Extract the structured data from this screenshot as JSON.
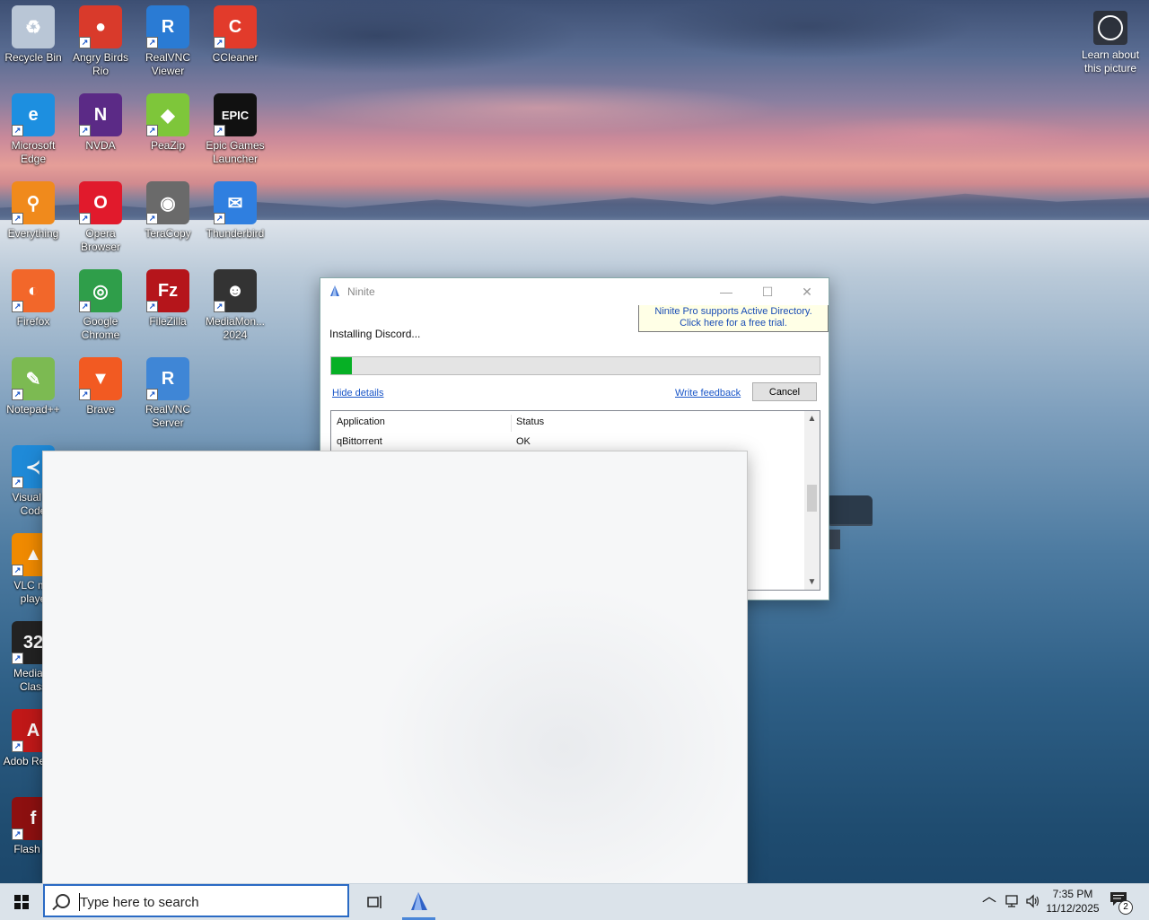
{
  "desktop": {
    "icons": [
      {
        "label": "Recycle Bin",
        "icon": "recycle-bin-icon"
      },
      {
        "label": "Angry Birds Rio",
        "icon": "angry-birds-icon"
      },
      {
        "label": "RealVNC Viewer",
        "icon": "realvnc-viewer-icon"
      },
      {
        "label": "CCleaner",
        "icon": "ccleaner-icon"
      },
      {
        "label": "Microsoft Edge",
        "icon": "edge-icon"
      },
      {
        "label": "NVDA",
        "icon": "nvda-icon"
      },
      {
        "label": "PeaZip",
        "icon": "peazip-icon"
      },
      {
        "label": "Epic Games Launcher",
        "icon": "epic-games-icon"
      },
      {
        "label": "Everything",
        "icon": "everything-search-icon"
      },
      {
        "label": "Opera Browser",
        "icon": "opera-icon"
      },
      {
        "label": "TeraCopy",
        "icon": "teracopy-icon"
      },
      {
        "label": "Thunderbird",
        "icon": "thunderbird-icon"
      },
      {
        "label": "Firefox",
        "icon": "firefox-icon"
      },
      {
        "label": "Google Chrome",
        "icon": "chrome-icon"
      },
      {
        "label": "FileZilla",
        "icon": "filezilla-icon"
      },
      {
        "label": "MediaMon... 2024",
        "icon": "mediamonkey-icon"
      },
      {
        "label": "Notepad++",
        "icon": "notepadpp-icon"
      },
      {
        "label": "Brave",
        "icon": "brave-icon"
      },
      {
        "label": "RealVNC Server",
        "icon": "realvnc-server-icon"
      },
      {
        "label": "Visual St Code",
        "icon": "vscode-icon"
      },
      {
        "label": "VLC me playe",
        "icon": "vlc-icon"
      },
      {
        "label": "Media P Class",
        "icon": "mpc-icon"
      },
      {
        "label": "Adob Reade",
        "icon": "adobe-reader-icon"
      },
      {
        "label": "Flash Pl",
        "icon": "flash-player-icon"
      }
    ],
    "learn_about": "Learn about this picture"
  },
  "ninite": {
    "title": "Ninite",
    "promo_line1": "Ninite Pro supports Active Directory.",
    "promo_line2": "Click here for a free trial.",
    "status": "Installing Discord...",
    "progress": 0.043,
    "hide_details": "Hide details",
    "write_feedback": "Write feedback",
    "cancel": "Cancel",
    "columns": [
      "Application",
      "Status"
    ],
    "rows": [
      {
        "application": "qBittorrent",
        "status": "OK"
      }
    ]
  },
  "taskbar": {
    "search_placeholder": "Type here to search",
    "time": "7:35 PM",
    "date": "11/12/2025",
    "notification_count": "2"
  },
  "colors": {
    "progress_fill": "#06b025",
    "link": "#1a56c8",
    "search_border": "#2a6ac4"
  }
}
